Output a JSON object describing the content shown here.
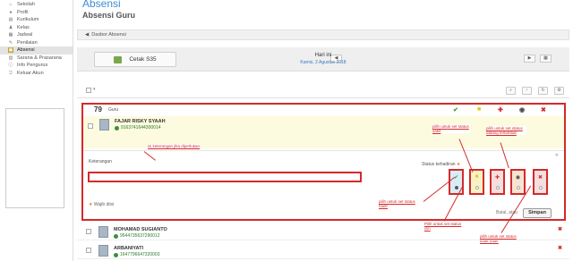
{
  "sidebar": {
    "items": [
      {
        "label": "Sekolah",
        "icon": "school-icon"
      },
      {
        "label": "Profil",
        "icon": "user-icon"
      },
      {
        "label": "Kurikulum",
        "icon": "book-icon"
      },
      {
        "label": "Kelas",
        "icon": "class-icon"
      },
      {
        "label": "Jadwal",
        "icon": "calendar-icon"
      },
      {
        "label": "Penilaian",
        "icon": "grade-icon"
      },
      {
        "label": "Absensi",
        "icon": "attendance-icon"
      },
      {
        "label": "Sarana & Prasarana",
        "icon": "building-icon"
      },
      {
        "label": "Info Pengurus",
        "icon": "info-icon"
      },
      {
        "label": "Keluar Akun",
        "icon": "logout-icon"
      }
    ]
  },
  "header": {
    "title": "Absensi",
    "subtitle": "Absensi Guru"
  },
  "breadcrumb": {
    "back_label": "Dasbor Absensi"
  },
  "toolbar": {
    "print_label": "Cetak S35",
    "day_label": "Hari ini",
    "date_label": "Kamis, 2 Agustus 2018"
  },
  "list": {
    "count": "79",
    "count_label": "Guru"
  },
  "teachers": [
    {
      "name": "FAJAR RISKY SYAAH",
      "nip": "9163741644300014"
    },
    {
      "name": "MOHAMAD SUGIANTO",
      "nip": "9544735637290012"
    },
    {
      "name": "ARBANIYATI",
      "nip": "1647796647320003"
    }
  ],
  "form": {
    "keterangan_label": "Keterangan",
    "status_label": "Status kehadiran",
    "required_note": "Wajib diisi",
    "cancel_label": "Batal, atau",
    "save_label": "Simpan"
  },
  "annotations": {
    "keterangan": "isi keterangan jika diperlukan",
    "sakit": "pilih untuk set status sakit",
    "terlambat": "pilih untuk set status datang terlambat",
    "hadir": "pilih untuk set status hadir",
    "izin": "Pilih untuk set status izin",
    "tidak_hadir": "pilih untuk set status tidak hadir"
  },
  "colors": {
    "accent": "#3b8dd6",
    "highlight": "#d42a2a",
    "row_highlight": "#fdfbdf"
  }
}
